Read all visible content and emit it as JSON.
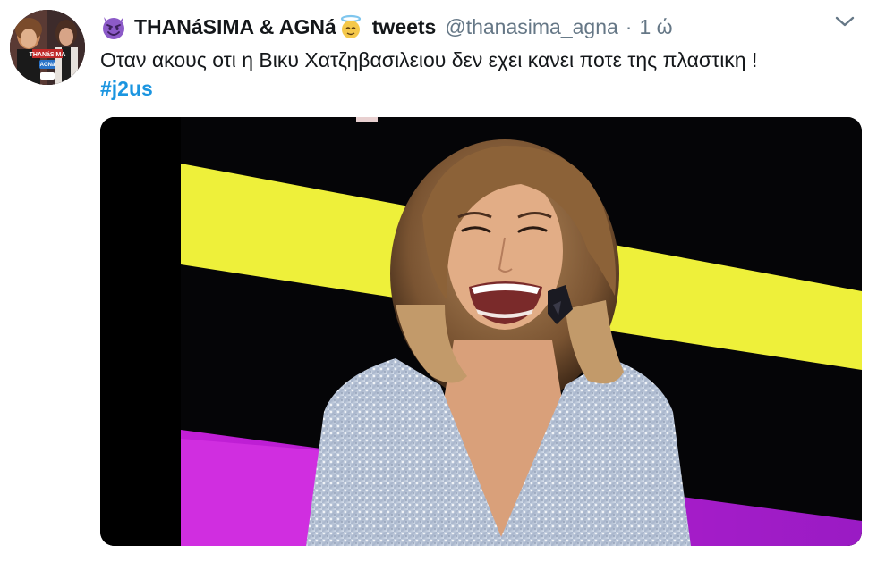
{
  "tweet": {
    "display_name_part1": "THANáSIMA & AGNá",
    "label": "tweets",
    "handle": "@thanasima_agna",
    "separator": "·",
    "time": "1 ώ",
    "text": "Οταν ακους οτι η Βικυ Χατζηβασιλειου δεν εχει κανει ποτε της πλαστικη !",
    "hashtag": "#j2us"
  },
  "icons": {
    "before_name": "smiling-devil-emoji-icon",
    "after_name": "angel-emoji-icon",
    "menu": "chevron-down-icon"
  },
  "colors": {
    "text": "#14171a",
    "muted": "#657786",
    "link": "#1b95e0",
    "devil_purple": "#8c5ac8",
    "stage_yellow": "#eef03a",
    "stage_magenta": "#c21fd6"
  },
  "avatar": {
    "sign_text": "THANáSIMA",
    "badge_text": "AGNá"
  }
}
